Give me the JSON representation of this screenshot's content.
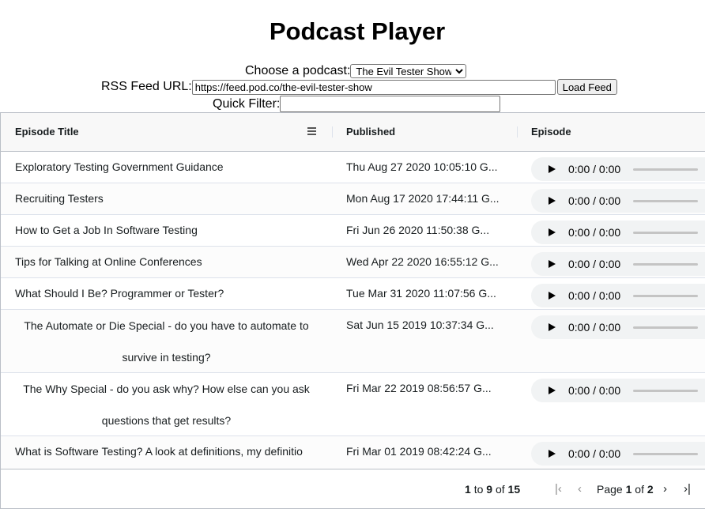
{
  "page_title": "Podcast Player",
  "controls": {
    "choose_label": "Choose a podcast:",
    "podcast_options": [
      "The Evil Tester Show"
    ],
    "selected_podcast": "The Evil Tester Show",
    "rss_label": "RSS Feed URL:",
    "rss_value": "https://feed.pod.co/the-evil-tester-show",
    "load_button": "Load Feed",
    "filter_label": "Quick Filter:",
    "filter_value": ""
  },
  "grid": {
    "columns": [
      "Episode Title",
      "Published",
      "Episode"
    ],
    "rows": [
      {
        "title": "Exploratory Testing Government Guidance",
        "published": "Thu Aug 27 2020 10:05:10 G...",
        "time": "0:00 / 0:00"
      },
      {
        "title": "Recruiting Testers",
        "published": "Mon Aug 17 2020 17:44:11 G...",
        "time": "0:00 / 0:00"
      },
      {
        "title": "How to Get a Job In Software Testing",
        "published": "Fri Jun 26 2020 11:50:38 G...",
        "time": "0:00 / 0:00"
      },
      {
        "title": "Tips for Talking at Online Conferences",
        "published": "Wed Apr 22 2020 16:55:12 G...",
        "time": "0:00 / 0:00"
      },
      {
        "title": "What Should I Be? Programmer or Tester?",
        "published": "Tue Mar 31 2020 11:07:56 G...",
        "time": "0:00 / 0:00"
      },
      {
        "title": "The Automate or Die Special - do you have to automate to survive in testing?",
        "published": "Sat Jun 15 2019 10:37:34 G...",
        "time": "0:00 / 0:00"
      },
      {
        "title": "The Why Special - do you ask why? How else can you ask questions that get results?",
        "published": "Fri Mar 22 2019 08:56:57 G...",
        "time": "0:00 / 0:00"
      },
      {
        "title": "What is Software Testing? A look at definitions, my definitio",
        "published": "Fri Mar 01 2019 08:42:24 G...",
        "time": "0:00 / 0:00"
      }
    ],
    "footer": {
      "range_from": "1",
      "to_word": "to",
      "range_to": "9",
      "of_word": "of",
      "total": "15",
      "page_word": "Page",
      "page_current": "1",
      "page_of_word": "of",
      "page_total": "2"
    }
  }
}
